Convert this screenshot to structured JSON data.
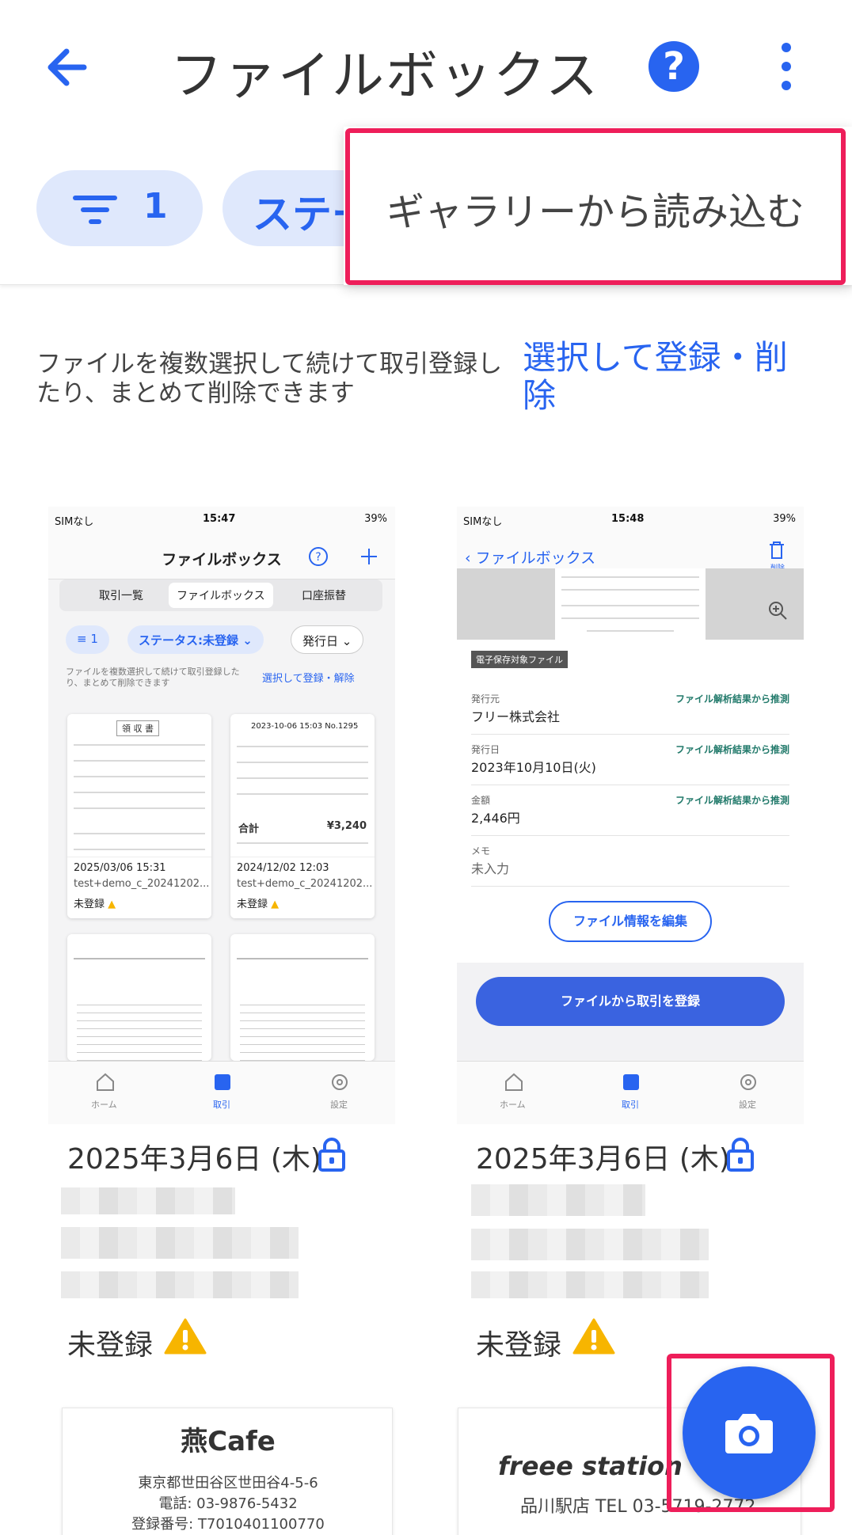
{
  "appbar": {
    "title": "ファイルボックス",
    "back_icon": "arrow-left-icon",
    "help_icon": "help-icon",
    "help_glyph": "?",
    "more_icon": "more-vert-icon"
  },
  "filters": {
    "filter_count": "1",
    "status_chip_label": "ステー"
  },
  "menu": {
    "item_label": "ギャラリーから読み込む"
  },
  "info": {
    "text": "ファイルを複数選択して続けて取引登録したり、まとめて削除できます",
    "link": "選択して登録・削除"
  },
  "cards": [
    {
      "date": "2025年3月6日 (木)",
      "status": "未登録",
      "phone": {
        "carrier": "SIMなし",
        "time": "15:47",
        "battery": "39%",
        "header_title": "ファイルボックス",
        "segments": [
          "取引一覧",
          "ファイルボックス",
          "口座振替"
        ],
        "chip_count": "1",
        "chip_status": "ステータス:未登録",
        "chip_date": "発行日",
        "info": "ファイルを複数選択して続けて取引登録したり、まとめて削除できます",
        "link": "選択して登録・解除",
        "receipts": [
          {
            "title": "領 収 書",
            "date": "2025/03/06 15:31",
            "file": "test+demo_c_20241202...",
            "status": "未登録"
          },
          {
            "title": "2023-10-06 15:03 No.1295",
            "date": "2024/12/02 12:03",
            "file": "test+demo_c_20241202...",
            "status": "未登録",
            "total_label": "合計",
            "total": "¥3,240"
          }
        ],
        "tabs": [
          "ホーム",
          "取引",
          "設定"
        ]
      }
    },
    {
      "date": "2025年3月6日 (木)",
      "status": "未登録",
      "phone": {
        "carrier": "SIMなし",
        "time": "15:48",
        "battery": "39%",
        "back_label": "ファイルボックス",
        "delete_label": "削除",
        "badge": "電子保存対象ファイル",
        "fields": [
          {
            "label": "発行元",
            "value": "フリー株式会社",
            "source": "ファイル解析結果から推測"
          },
          {
            "label": "発行日",
            "value": "2023年10月10日(火)",
            "source": "ファイル解析結果から推測"
          },
          {
            "label": "金額",
            "value": "2,446円",
            "source": "ファイル解析結果から推測"
          },
          {
            "label": "メモ",
            "value": "未入力",
            "source": ""
          }
        ],
        "edit_button": "ファイル情報を編集",
        "register_button": "ファイルから取引を登録",
        "tabs": [
          "ホーム",
          "取引",
          "設定"
        ]
      }
    }
  ],
  "bottom_receipts": [
    {
      "shop": "燕Cafe",
      "line1": "東京都世田谷区世田谷4-5-6",
      "line2": "電話: 03-9876-5432",
      "line3": "登録番号: T7010401100770"
    },
    {
      "shop": "freee station",
      "line1": "品川駅店 TEL 03-5719-2772"
    }
  ],
  "fab": {
    "icon": "camera-icon"
  },
  "colors": {
    "primary": "#2864f0",
    "chip_bg": "#dfe8fc",
    "highlight": "#ee1e5a",
    "warning": "#f7b500"
  }
}
